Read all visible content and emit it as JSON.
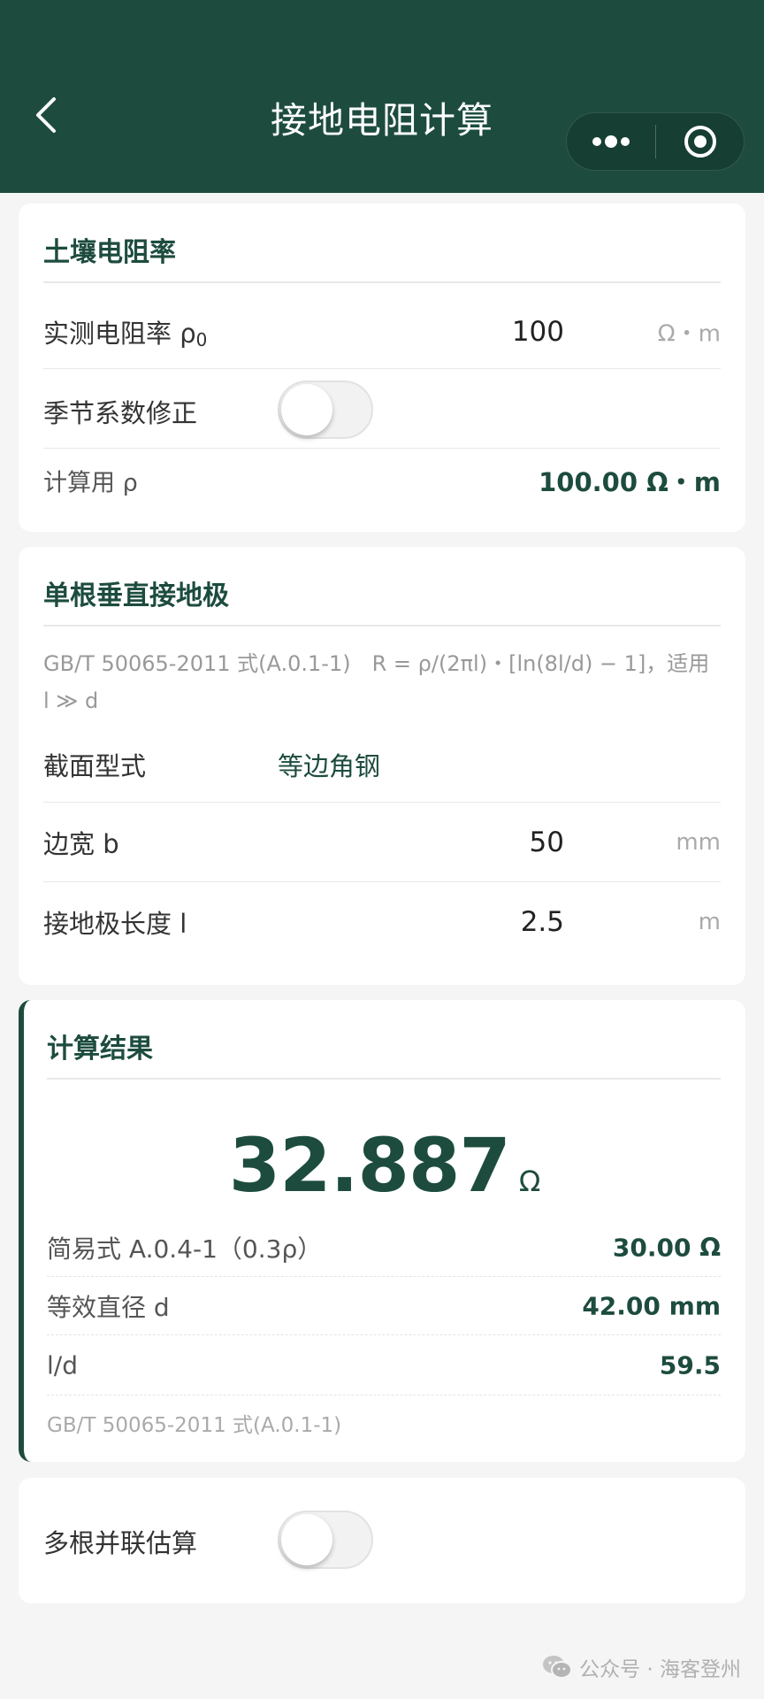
{
  "nav": {
    "title": "接地电阻计算"
  },
  "soil": {
    "title": "土壤电阻率",
    "measured_label": "实测电阻率 ρ",
    "measured_sub": "0",
    "measured_value": "100",
    "measured_unit": "Ω・m",
    "season_label": "季节系数修正",
    "season_enabled": false,
    "calc_label": "计算用 ρ",
    "calc_value": "100.00 Ω・m"
  },
  "electrode": {
    "title": "单根垂直接地极",
    "formula": "GB/T 50065-2011 式(A.0.1-1)　R = ρ/(2πl)・[ln(8l/d) − 1]，适用 l ≫ d",
    "section_label": "截面型式",
    "section_value": "等边角钢",
    "width_label": "边宽 b",
    "width_value": "50",
    "width_unit": "mm",
    "length_label": "接地极长度 l",
    "length_value": "2.5",
    "length_unit": "m"
  },
  "result": {
    "title": "计算结果",
    "value": "32.887",
    "unit": "Ω",
    "rows": [
      {
        "label": "简易式 A.0.4-1（0.3ρ）",
        "value": "30.00 Ω"
      },
      {
        "label": "等效直径 d",
        "value": "42.00 mm"
      },
      {
        "label": "l/d",
        "value": "59.5"
      }
    ],
    "reference": "GB/T 50065-2011 式(A.0.1-1)"
  },
  "parallel": {
    "label": "多根并联估算",
    "enabled": false
  },
  "watermark": {
    "text": "公众号 · 海客登州"
  },
  "colors": {
    "primary": "#1d4c3f",
    "background": "#f5f5f5"
  }
}
